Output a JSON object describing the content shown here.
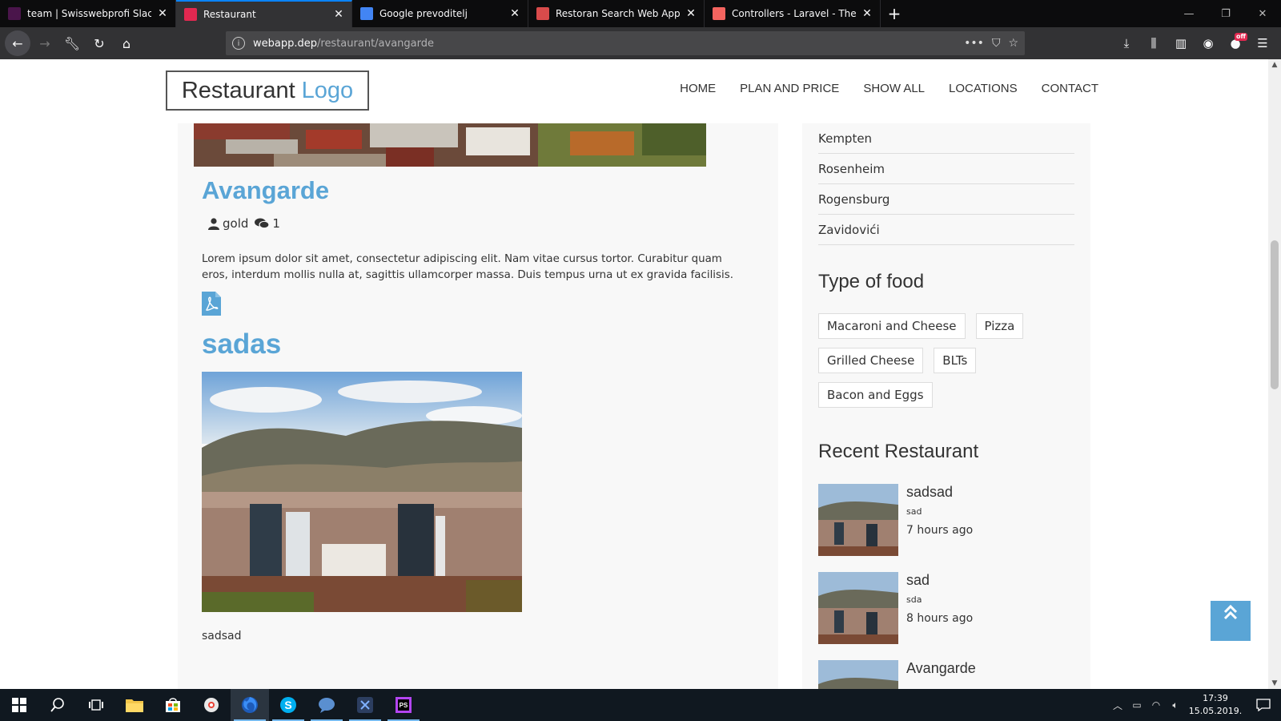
{
  "browser": {
    "tabs": [
      {
        "title": "team | Swisswebprofi Slack",
        "favicon_color": "#4a154b",
        "active": false
      },
      {
        "title": "Restaurant",
        "favicon_color": "#e22850",
        "active": true
      },
      {
        "title": "Google prevoditelj",
        "favicon_color": "#4285f4",
        "active": false
      },
      {
        "title": "Restoran Search Web App on W",
        "favicon_color": "#d94b4b",
        "active": false
      },
      {
        "title": "Controllers - Laravel - The PHP",
        "favicon_color": "#f4645f",
        "active": false
      }
    ],
    "close_glyph": "✕",
    "newtab_glyph": "+",
    "url_host": "webapp.dep",
    "url_path": "/restaurant/avangarde",
    "url_actions": [
      "•••",
      "⛉",
      "☆"
    ],
    "extension_badge": "off"
  },
  "site": {
    "logo_text": "Restaurant",
    "logo_accent": "Logo",
    "nav": [
      "HOME",
      "PLAN AND PRICE",
      "SHOW ALL",
      "LOCATIONS",
      "CONTACT"
    ],
    "accent_color": "#5aa5d6"
  },
  "post": {
    "title": "Avangarde",
    "author": "gold",
    "comments": "1",
    "body": "Lorem ipsum dolor sit amet, consectetur adipiscing elit. Nam vitae cursus tortor. Curabitur quam eros, interdum mollis nulla at, sagittis ullamcorper massa. Duis tempus urna ut ex gravida facilisis."
  },
  "post2": {
    "title": "sadas",
    "caption": "sadsad"
  },
  "sidebar": {
    "locations": [
      "Kempten",
      "Rosenheim",
      "Rogensburg",
      "Zavidovići"
    ],
    "food_heading": "Type of food",
    "food_tags": [
      "Macaroni and Cheese",
      "Pizza",
      "Grilled Cheese",
      "BLTs",
      "Bacon and Eggs"
    ],
    "recent_heading": "Recent Restaurant",
    "recent": [
      {
        "title": "sadsad",
        "sub": "sad",
        "time": "7 hours ago"
      },
      {
        "title": "sad",
        "sub": "sda",
        "time": "8 hours ago"
      },
      {
        "title": "Avangarde",
        "sub": "",
        "time": ""
      }
    ]
  },
  "taskbar": {
    "time": "17:39",
    "date": "15.05.2019."
  }
}
